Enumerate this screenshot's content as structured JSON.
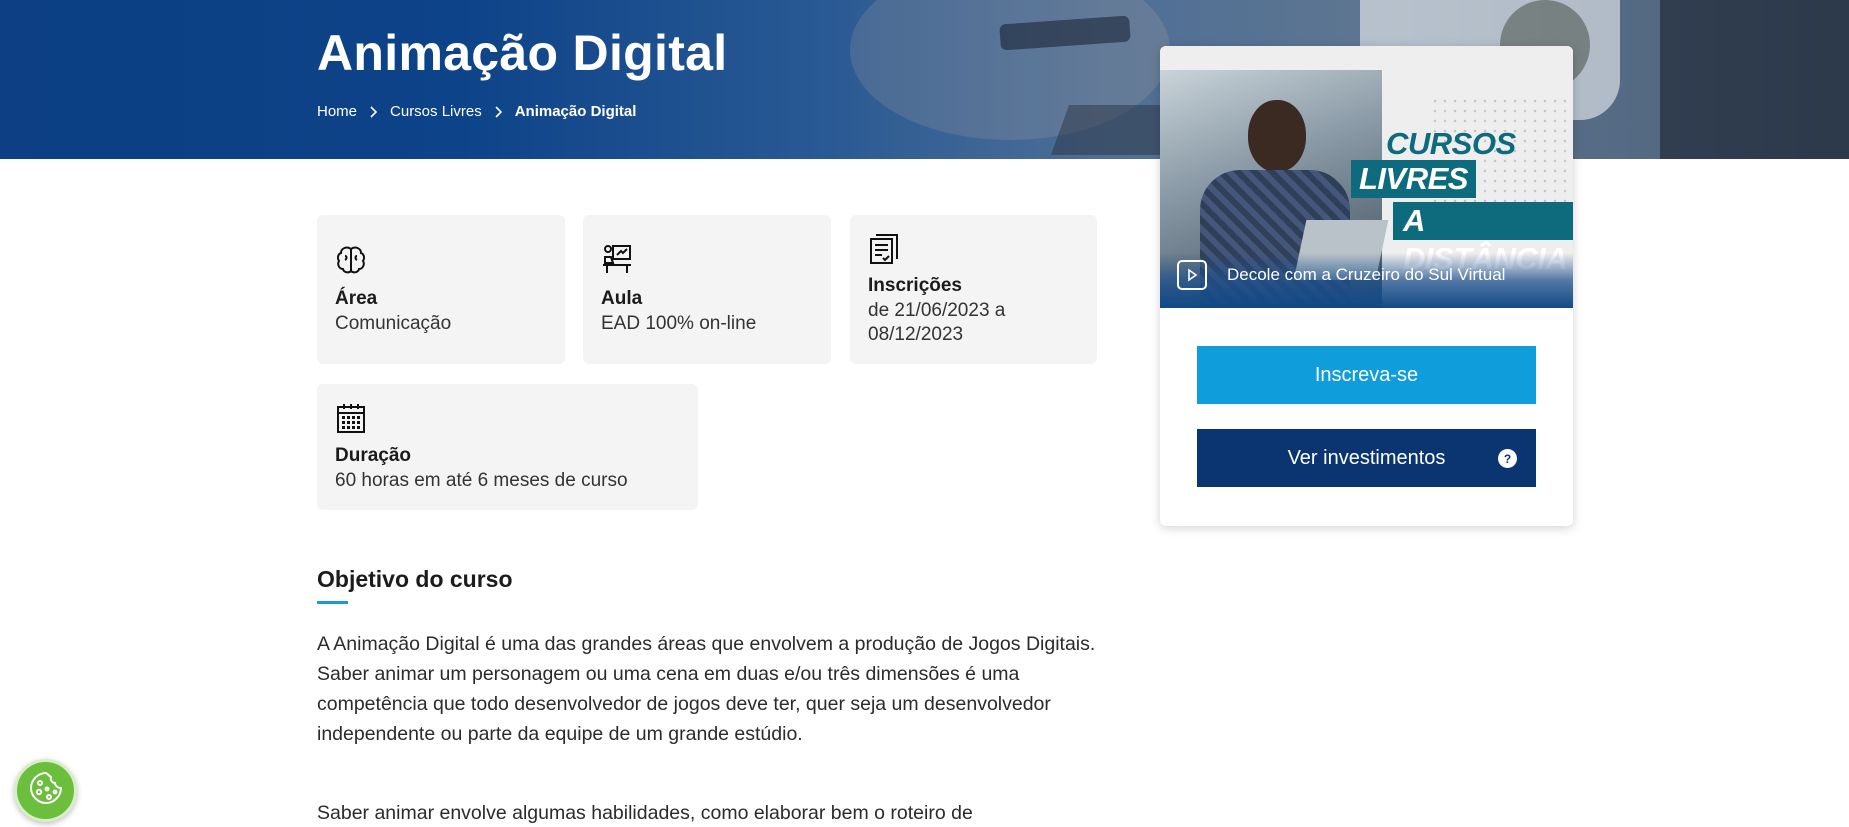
{
  "hero": {
    "title": "Animação Digital",
    "breadcrumb": [
      "Home",
      "Cursos Livres",
      "Animação Digital"
    ]
  },
  "info_cards": [
    {
      "icon": "brain-icon",
      "label": "Área",
      "value": "Comunicação"
    },
    {
      "icon": "teacher-desk-icon",
      "label": "Aula",
      "value": "EAD 100% on-line"
    },
    {
      "icon": "document-list-icon",
      "label": "Inscrições",
      "value_line1": "de 21/06/2023 a",
      "value_line2": "08/12/2023"
    },
    {
      "icon": "calendar-icon",
      "label": "Duração",
      "value": "60 horas em até 6 meses de curso"
    }
  ],
  "section": {
    "title": "Objetivo do curso",
    "paragraphs": [
      "A Animação Digital é uma das grandes áreas que envolvem a produção de Jogos Digitais. Saber animar um personagem ou uma cena em duas e/ou três dimensões é uma competência que todo desenvolvedor de jogos deve ter, quer seja um desenvolvedor independente ou parte da equipe de um grande estúdio.",
      "Saber animar envolve algumas habilidades, como elaborar bem o roteiro de"
    ]
  },
  "sidebar": {
    "promo": {
      "line1": "CURSOS",
      "line2": "LIVRES",
      "line3": "A DISTÂNCIA",
      "caption": "Decole com a Cruzeiro do Sul Virtual",
      "icon": "play-icon"
    },
    "enroll_label": "Inscreva-se",
    "invest_label": "Ver investimentos",
    "help_glyph": "?"
  },
  "cookie": {
    "icon": "cookie-icon"
  },
  "colors": {
    "hero_blue": "#0c3f83",
    "accent_blue": "#0f9ddc",
    "navy": "#0a3571",
    "teal": "#0e6b7e",
    "cookie_green": "#6bbf3c",
    "card_bg": "#f4f4f4"
  }
}
